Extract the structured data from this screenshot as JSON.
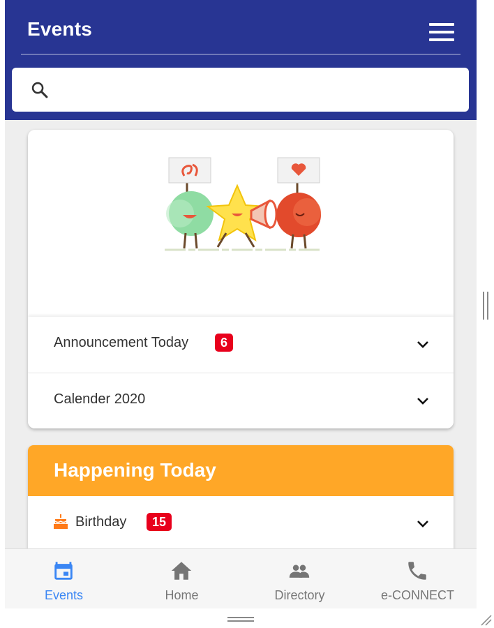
{
  "header": {
    "title": "Events",
    "menu_icon": "hamburger-menu-icon",
    "color": "#283593"
  },
  "search": {
    "icon": "search-icon",
    "placeholder": "",
    "value": ""
  },
  "events_card": {
    "illustration": "celebration-characters-illustration",
    "rows": [
      {
        "label": "Announcement Today",
        "badge": "6"
      },
      {
        "label": "Calender 2020",
        "badge": ""
      }
    ]
  },
  "happening_today": {
    "title": "Happening Today",
    "color": "#ffa727",
    "rows": [
      {
        "icon": "cake-icon",
        "label": "Birthday",
        "badge": "15"
      }
    ]
  },
  "bottom_nav": {
    "items": [
      {
        "label": "Events",
        "icon": "calendar-icon",
        "active": true
      },
      {
        "label": "Home",
        "icon": "home-icon",
        "active": false
      },
      {
        "label": "Directory",
        "icon": "people-icon",
        "active": false
      },
      {
        "label": "e-CONNECT",
        "icon": "phone-icon",
        "active": false
      }
    ],
    "active_color": "#3a86f4"
  },
  "colors": {
    "badge": "#e8001c",
    "background": "#eeeeee"
  }
}
